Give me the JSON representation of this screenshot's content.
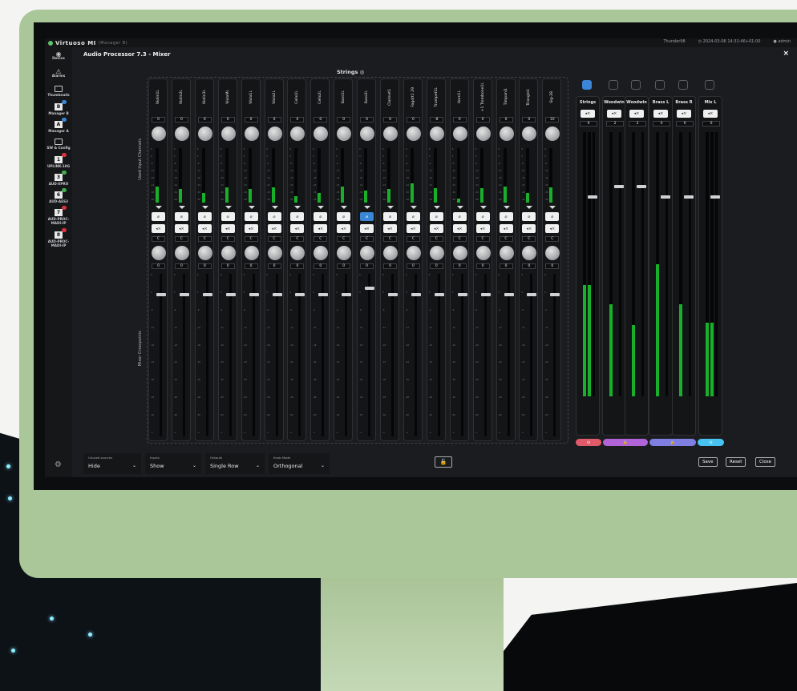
{
  "app": {
    "name": "Virtuoso MI",
    "subtitle": "(Manager B)",
    "user_name": "Thunder98",
    "datetime": "2024-03-06 14:31:46+01:00",
    "user": "admin"
  },
  "sidebar": {
    "items": [
      {
        "label": "Device",
        "icon": "eye-icon"
      },
      {
        "label": "Alarms",
        "icon": "warning-icon"
      },
      {
        "label": "Thumbnails",
        "icon": "thumbnails-icon"
      },
      {
        "label": "Manager B",
        "num": "B"
      },
      {
        "label": "Manager A",
        "num": "A"
      },
      {
        "label": "SW & Config",
        "icon": "window-icon"
      },
      {
        "label": "UPLINK-10G",
        "num": "1"
      },
      {
        "label": "AUD-XPRO",
        "num": "3"
      },
      {
        "label": "AUD-AES3",
        "num": "6"
      },
      {
        "label": "AUD-PROC-MADI-IP",
        "num": "7"
      },
      {
        "label": "AUD-PROC-MADI-IP",
        "num": "8"
      }
    ]
  },
  "panel": {
    "title": "Audio Processor 7.3 - Mixer",
    "close": "×",
    "group_title": "Strings",
    "label_used_inputs": "Used Input Channels",
    "label_mixer": "Mixer Crosspoints"
  },
  "channels": [
    {
      "name": "Violin1L",
      "gain": "0"
    },
    {
      "name": "Violin2L",
      "gain": "0"
    },
    {
      "name": "Violin3L",
      "gain": "0"
    },
    {
      "name": "ViolaML",
      "gain": "0"
    },
    {
      "name": "Viola1L",
      "gain": "0"
    },
    {
      "name": "Viola2L",
      "gain": "0"
    },
    {
      "name": "Cello1L",
      "gain": "0"
    },
    {
      "name": "Cello2L",
      "gain": "0"
    },
    {
      "name": "Bass1L",
      "gain": "0"
    },
    {
      "name": "Bass2L",
      "gain": "0"
    },
    {
      "name": "Clarinet1",
      "gain": "0"
    },
    {
      "name": "Fagott1 29",
      "gain": "0"
    },
    {
      "name": "Trumpet1L",
      "gain": "-8"
    },
    {
      "name": "Horn1L",
      "gain": "0"
    },
    {
      "name": "+1 Trombone1L",
      "gain": "0"
    },
    {
      "name": "Timpani1",
      "gain": "0"
    },
    {
      "name": "Triangle1",
      "gain": "0"
    },
    {
      "name": "Sig-28",
      "gain": "10"
    }
  ],
  "outputs": [
    {
      "name": "Strings",
      "value": "0"
    },
    {
      "name": "Woodwin",
      "value": "2"
    },
    {
      "name": "Woodwin",
      "value": "2"
    },
    {
      "name": "Brass L",
      "value": "0"
    },
    {
      "name": "Brass R",
      "value": "0"
    },
    {
      "name": "Mix L",
      "value": "0"
    }
  ],
  "controls": {
    "unused_sources": {
      "label": "Unused sources",
      "value": "Hide"
    },
    "inputs": {
      "label": "Inputs",
      "value": "Show"
    },
    "outputs": {
      "label": "Outputs",
      "value": "Single Row"
    },
    "knob_mode": {
      "label": "Knob Mode",
      "value": "Orthogonal"
    }
  },
  "buttons": {
    "save": "Save",
    "reset": "Reset",
    "close": "Close"
  },
  "colors": {
    "meter_green": "#18b02a",
    "select_blue": "#3b86d6",
    "link_red": "#e05a6a",
    "link_purple": "#b064d8",
    "link_blue": "#7e7fe0",
    "link_cyan": "#46c3f0"
  }
}
